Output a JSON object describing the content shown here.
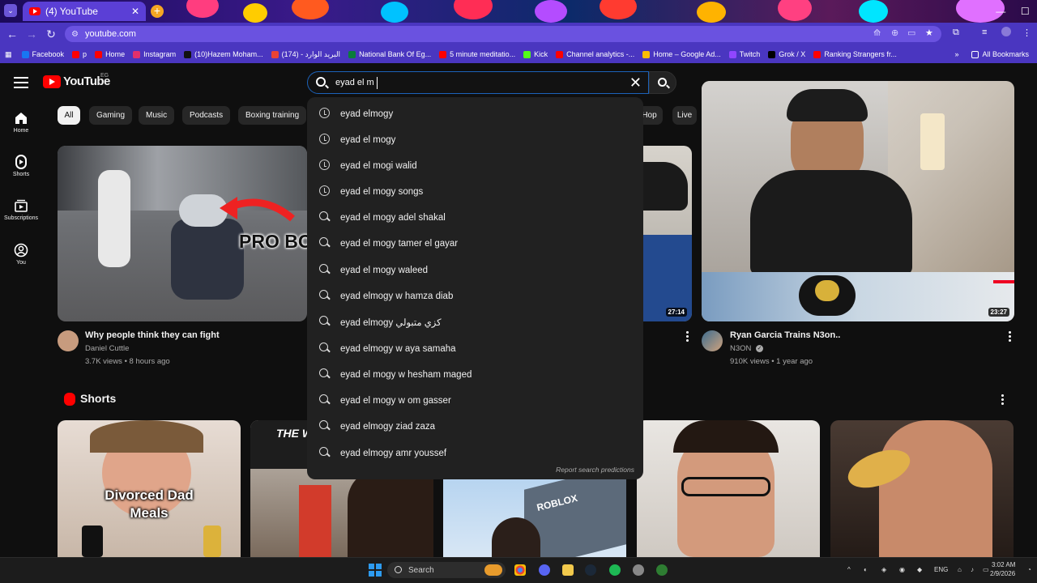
{
  "browser": {
    "tab_title": "(4) YouTube",
    "tab_close": "✕",
    "new_tab": "+",
    "url": "youtube.com",
    "bookmarks": [
      {
        "label": "Facebook",
        "color": "#1877f2"
      },
      {
        "label": "p",
        "color": "#ff0000"
      },
      {
        "label": "Home",
        "color": "#ff0000"
      },
      {
        "label": "Instagram",
        "color": "#e1306c"
      },
      {
        "label": "(10)Hazem Moham...",
        "color": "#111111"
      },
      {
        "label": "(174) - البريد الوارد",
        "color": "#ea4335"
      },
      {
        "label": "National Bank Of Eg...",
        "color": "#0a7d3b"
      },
      {
        "label": "5 minute meditatio...",
        "color": "#ff0000"
      },
      {
        "label": "Kick",
        "color": "#53fc18"
      },
      {
        "label": "Channel analytics -...",
        "color": "#ff0000"
      },
      {
        "label": "Home – Google Ad...",
        "color": "#fbbc05"
      },
      {
        "label": "Twitch",
        "color": "#9146ff"
      },
      {
        "label": "Grok / X",
        "color": "#000000"
      },
      {
        "label": "Ranking Strangers fr...",
        "color": "#ff0000"
      }
    ],
    "all_bookmarks": "All Bookmarks",
    "more_bookmarks": "»"
  },
  "youtube": {
    "logo_text": "YouTube",
    "country": "EG",
    "search": {
      "value": "eyad el m",
      "clear": "✕",
      "suggestions": [
        {
          "text": "eyad elmogy",
          "kind": "history"
        },
        {
          "text": "eyad el mogy",
          "kind": "history"
        },
        {
          "text": "eyad el mogi walid",
          "kind": "history"
        },
        {
          "text": "eyad el mogy songs",
          "kind": "history"
        },
        {
          "text": "eyad el mogy adel shakal",
          "kind": "search"
        },
        {
          "text": "eyad el mogy tamer el gayar",
          "kind": "search"
        },
        {
          "text": "eyad el mogy waleed",
          "kind": "search"
        },
        {
          "text": "eyad elmogy w hamza diab",
          "kind": "search"
        },
        {
          "text": "eyad elmogy كزي متبولي",
          "kind": "search"
        },
        {
          "text": "eyad elmogy w aya samaha",
          "kind": "search"
        },
        {
          "text": "eyad el mogy w hesham maged",
          "kind": "search"
        },
        {
          "text": "eyad el mogy w om gasser",
          "kind": "search"
        },
        {
          "text": "eyad elmogy ziad zaza",
          "kind": "search"
        },
        {
          "text": "eyad elmogy amr youssef",
          "kind": "search"
        }
      ],
      "report": "Report search predictions"
    },
    "sidebar": [
      {
        "label": "Home"
      },
      {
        "label": "Shorts"
      },
      {
        "label": "Subscriptions"
      },
      {
        "label": "You"
      }
    ],
    "chips": [
      "All",
      "Gaming",
      "Music",
      "Podcasts",
      "Boxing training",
      "Hop",
      "Live"
    ],
    "videos": [
      {
        "title": "Why people think they can fight",
        "channel": "Daniel Cuttle",
        "meta": "3.7K views • 8 hours ago",
        "overlay": "PRO BO"
      },
      {
        "duration": "27:14"
      },
      {
        "title": "Ryan Garcia Trains N3on..",
        "channel": "N3ON",
        "meta": "910K views • 1 year ago",
        "duration": "23:27"
      }
    ],
    "shorts_title": "Shorts",
    "shorts": [
      {
        "caption": "Divorced Dad\nMeals"
      },
      {
        "caption": "THE W"
      },
      {
        "caption": "ROBLOX"
      },
      {
        "caption": ""
      },
      {
        "caption": ""
      }
    ]
  },
  "taskbar": {
    "search": "Search",
    "lang": "ENG",
    "time": "3:02 AM",
    "date": "2/9/2026"
  }
}
